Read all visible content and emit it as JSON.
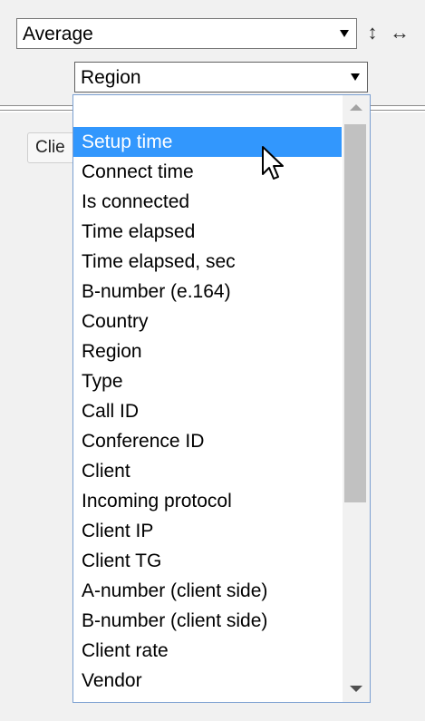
{
  "toolbar": {
    "aggregate_select": {
      "value": "Average"
    },
    "resize_vertical_glyph": "↕",
    "resize_horizontal_glyph": "↔",
    "group_by_select": {
      "value": "Region"
    }
  },
  "background_tab": {
    "label": "Clie"
  },
  "dropdown": {
    "options": [
      {
        "label": ""
      },
      {
        "label": "Setup time",
        "highlighted": true
      },
      {
        "label": "Connect time"
      },
      {
        "label": "Is connected"
      },
      {
        "label": "Time elapsed"
      },
      {
        "label": "Time elapsed, sec"
      },
      {
        "label": "B-number (e.164)"
      },
      {
        "label": "Country"
      },
      {
        "label": "Region"
      },
      {
        "label": "Type"
      },
      {
        "label": "Call ID"
      },
      {
        "label": "Conference ID"
      },
      {
        "label": "Client"
      },
      {
        "label": "Incoming protocol"
      },
      {
        "label": "Client IP"
      },
      {
        "label": "Client TG"
      },
      {
        "label": "A-number (client side)"
      },
      {
        "label": "B-number (client side)"
      },
      {
        "label": "Client rate"
      },
      {
        "label": "Vendor"
      }
    ]
  },
  "icons": {
    "dropdown_arrow": "chevron-down-icon",
    "cursor": "mouse-pointer-icon",
    "scroll_up": "scroll-up-arrow-icon",
    "scroll_down": "scroll-down-arrow-icon"
  },
  "colors": {
    "highlight": "#3297fd",
    "dropdown_border": "#7a9fd1",
    "panel_background": "#f1f1f1"
  }
}
